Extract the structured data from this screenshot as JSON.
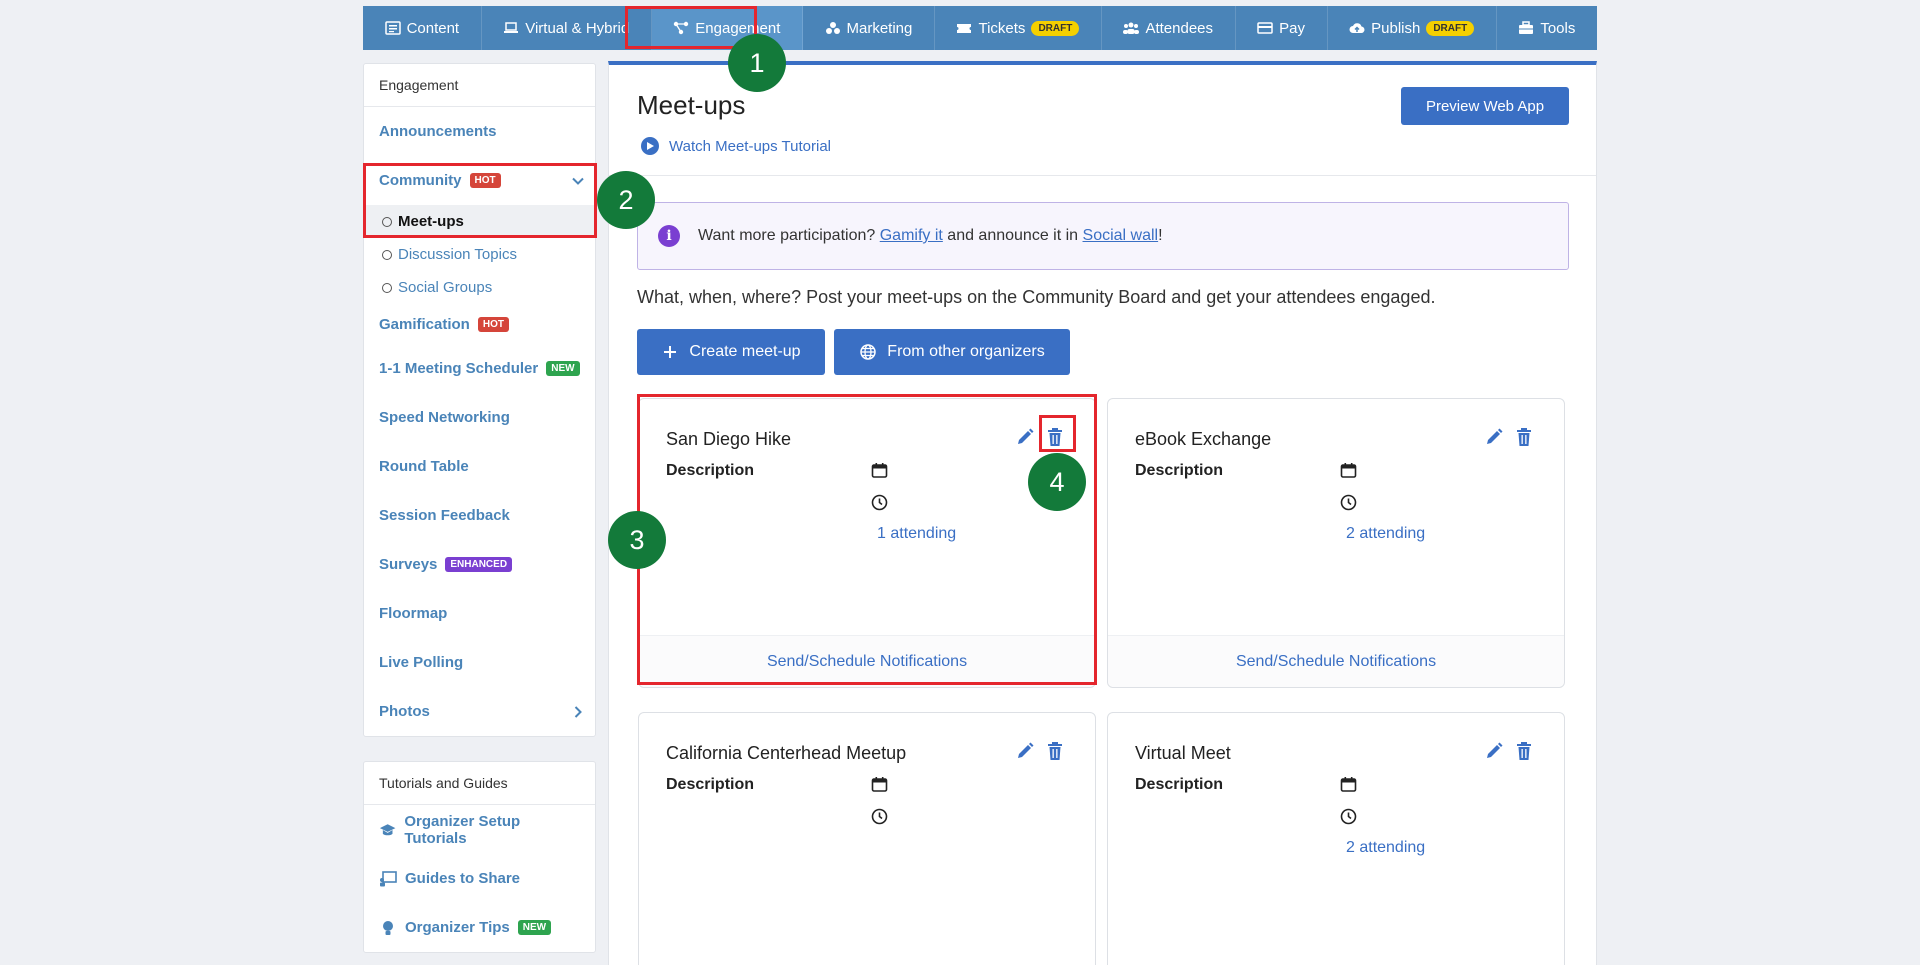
{
  "topnav": [
    {
      "label": "Content",
      "icon": "content-icon"
    },
    {
      "label": "Virtual & Hybrid",
      "icon": "laptop-icon"
    },
    {
      "label": "Engagement",
      "icon": "engagement-icon",
      "active": true
    },
    {
      "label": "Marketing",
      "icon": "marketing-icon"
    },
    {
      "label": "Tickets",
      "icon": "ticket-icon",
      "badge": "DRAFT"
    },
    {
      "label": "Attendees",
      "icon": "attendees-icon"
    },
    {
      "label": "Pay",
      "icon": "card-icon"
    },
    {
      "label": "Publish",
      "icon": "cloud-upload-icon",
      "badge": "DRAFT"
    },
    {
      "label": "Tools",
      "icon": "toolbox-icon"
    }
  ],
  "sidebar": {
    "header": "Engagement",
    "items": {
      "announcements": "Announcements",
      "community": "Community",
      "community_badge": "HOT",
      "meetups": "Meet-ups",
      "discussion": "Discussion Topics",
      "social": "Social Groups",
      "gamification": "Gamification",
      "gamification_badge": "HOT",
      "scheduler": "1-1 Meeting Scheduler",
      "scheduler_badge": "NEW",
      "speed": "Speed Networking",
      "round": "Round Table",
      "feedback": "Session Feedback",
      "surveys": "Surveys",
      "surveys_badge": "ENHANCED",
      "floormap": "Floormap",
      "polling": "Live Polling",
      "photos": "Photos"
    },
    "tutorials": {
      "header": "Tutorials and Guides",
      "setup": "Organizer Setup Tutorials",
      "guides": "Guides to Share",
      "tips": "Organizer Tips",
      "tips_badge": "NEW"
    }
  },
  "main": {
    "title": "Meet-ups",
    "tutorial_link": "Watch Meet-ups Tutorial",
    "preview_button": "Preview Web App",
    "info": {
      "prefix": "Want more participation? ",
      "gamify_link": "Gamify it",
      "middle": " and announce it in ",
      "social_link": "Social wall",
      "suffix": "!"
    },
    "description": "What, when, where? Post your meet-ups on the Community Board and get your attendees engaged.",
    "create_button": "Create meet-up",
    "other_button": "From other organizers",
    "cards": [
      {
        "title": "San Diego Hike",
        "desc_label": "Description",
        "attending": "1 attending",
        "footer": "Send/Schedule Notifications"
      },
      {
        "title": "eBook Exchange",
        "desc_label": "Description",
        "attending": "2 attending",
        "footer": "Send/Schedule Notifications"
      },
      {
        "title": "California Centerhead Meetup",
        "desc_label": "Description",
        "attending": "",
        "footer": ""
      },
      {
        "title": "Virtual Meet",
        "desc_label": "Description",
        "attending": "2 attending",
        "footer": ""
      }
    ]
  },
  "markers": [
    "1",
    "2",
    "3",
    "4"
  ],
  "colors": {
    "nav": "#4a84b8",
    "primary": "#3a6fc4",
    "highlight": "#e4262d",
    "marker": "#137a3a"
  }
}
